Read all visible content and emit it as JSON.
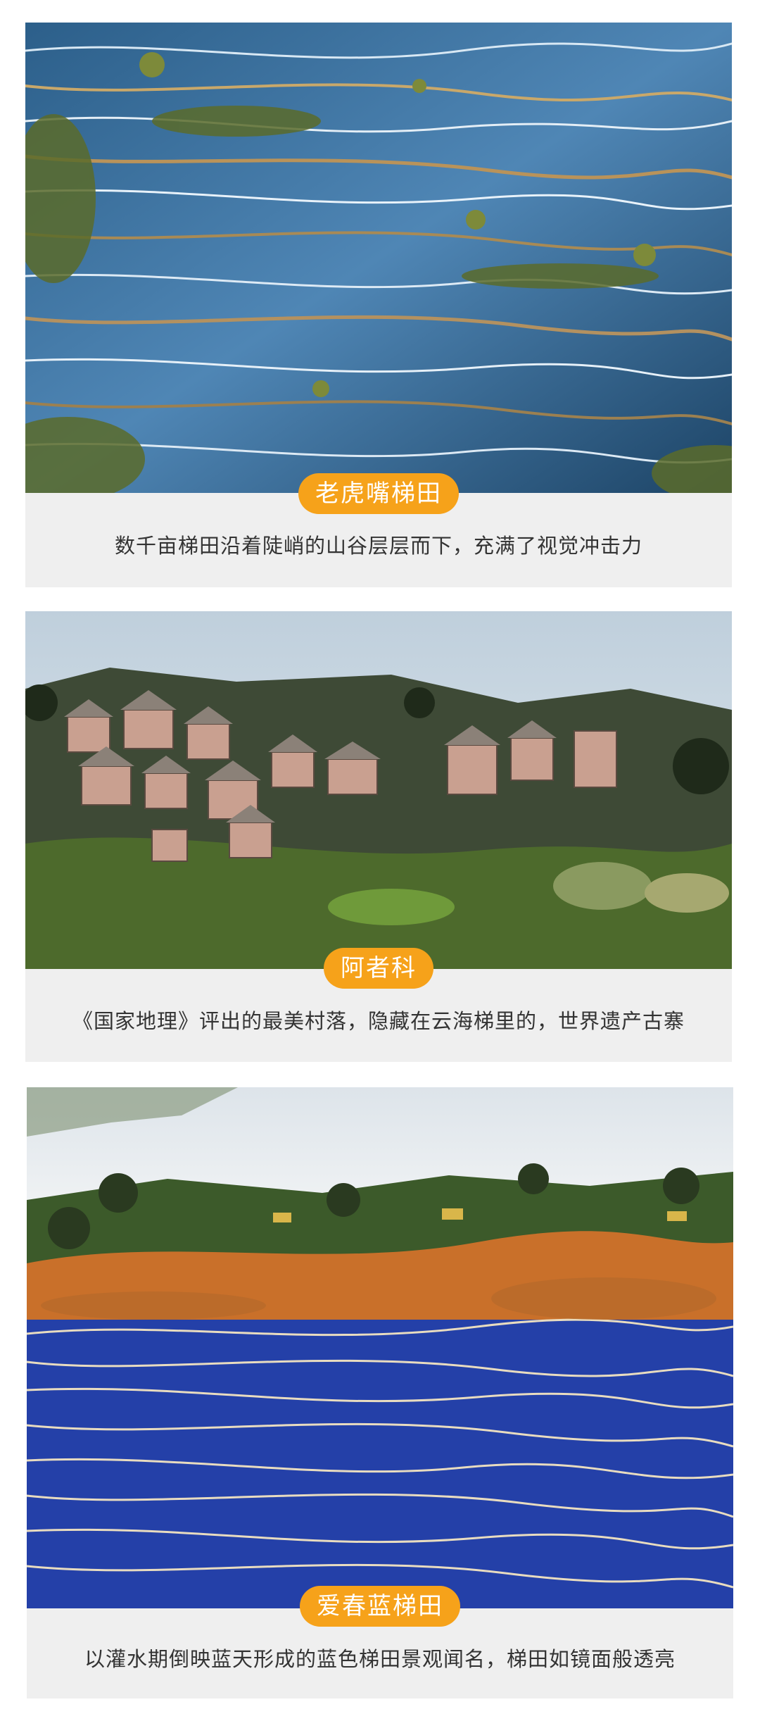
{
  "cards": [
    {
      "title": "老虎嘴梯田",
      "caption": "数千亩梯田沿着陡峭的山谷层层而下，充满了视觉冲击力",
      "image": "terraced-rice-fields-photo"
    },
    {
      "title": "阿者科",
      "caption": "《国家地理》评出的最美村落，隐藏在云海梯里的，世界遗产古寨",
      "image": "hillside-village-photo"
    },
    {
      "title": "爱春蓝梯田",
      "caption": "以灌水期倒映蓝天形成的蓝色梯田景观闻名，梯田如镜面般透亮",
      "image": "blue-terraces-photo"
    }
  ],
  "colors": {
    "pill": "#f6a21a",
    "caption_bg": "#efefef",
    "caption_text": "#333333"
  }
}
